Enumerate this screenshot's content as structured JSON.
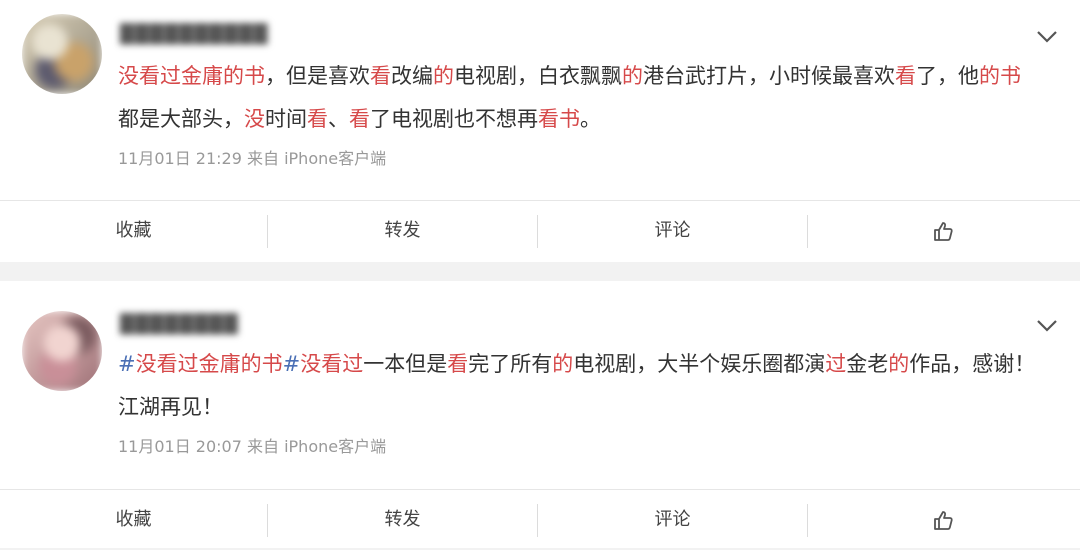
{
  "posts": [
    {
      "username": "██████████",
      "content": [
        {
          "t": "没看过金庸的书",
          "hl": true
        },
        {
          "t": "，但是喜欢",
          "hl": false
        },
        {
          "t": "看",
          "hl": true
        },
        {
          "t": "改编",
          "hl": false
        },
        {
          "t": "的",
          "hl": true
        },
        {
          "t": "电视剧，白衣飘飘",
          "hl": false
        },
        {
          "t": "的",
          "hl": true
        },
        {
          "t": "港台武打片，小时候最喜欢",
          "hl": false
        },
        {
          "t": "看",
          "hl": true
        },
        {
          "t": "了，他",
          "hl": false
        },
        {
          "t": "的书",
          "hl": true
        },
        {
          "t": "都是大部头，",
          "hl": false
        },
        {
          "t": "没",
          "hl": true
        },
        {
          "t": "时间",
          "hl": false
        },
        {
          "t": "看",
          "hl": true
        },
        {
          "t": "、",
          "hl": false
        },
        {
          "t": "看",
          "hl": true
        },
        {
          "t": "了电视剧也不想再",
          "hl": false
        },
        {
          "t": "看书",
          "hl": true
        },
        {
          "t": "。",
          "hl": false
        }
      ],
      "meta": "11月01日 21:29 来自 iPhone客户端"
    },
    {
      "username": "████████",
      "content": [
        {
          "t": "#",
          "tag": true
        },
        {
          "t": "没看过金庸的书",
          "hl": true
        },
        {
          "t": "#",
          "tag": true
        },
        {
          "t": "没看过",
          "hl": true
        },
        {
          "t": "一本但是",
          "hl": false
        },
        {
          "t": "看",
          "hl": true
        },
        {
          "t": "完了所有",
          "hl": false
        },
        {
          "t": "的",
          "hl": true
        },
        {
          "t": "电视剧，大半个娱乐圈都演",
          "hl": false
        },
        {
          "t": "过",
          "hl": true
        },
        {
          "t": "金老",
          "hl": false
        },
        {
          "t": "的",
          "hl": true
        },
        {
          "t": "作品，感谢！江湖再见！",
          "hl": false
        }
      ],
      "meta": "11月01日 20:07 来自 iPhone客户端"
    }
  ],
  "toolbar": {
    "favorite": "收藏",
    "repost": "转发",
    "comment": "评论"
  },
  "icons": {
    "more": "chevron-down-icon",
    "like": "thumbs-up-icon"
  },
  "colors": {
    "highlight": "#d6494a",
    "hashtag": "#4a6fb5",
    "meta": "#999999"
  }
}
